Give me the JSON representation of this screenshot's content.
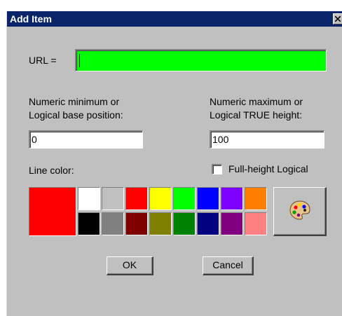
{
  "window": {
    "title": "Add Item",
    "close_icon": "close-icon"
  },
  "url": {
    "label": "URL =",
    "value": ""
  },
  "minimum": {
    "label_line1": "Numeric minimum or",
    "label_line2": "Logical base position:",
    "value": "0"
  },
  "maximum": {
    "label_line1": "Numeric maximum or",
    "label_line2": "Logical TRUE height:",
    "value": "100"
  },
  "line_color": {
    "label": "Line color:",
    "selected": "#ff0000"
  },
  "full_height": {
    "label": "Full-height Logical",
    "checked": false
  },
  "swatches_top": [
    "#ffffff",
    "#c0c0c0",
    "#ff0000",
    "#ffff00",
    "#00ff00",
    "#0000ff",
    "#8000ff",
    "#ff8000"
  ],
  "swatches_bottom": [
    "#000000",
    "#808080",
    "#800000",
    "#808000",
    "#008000",
    "#000080",
    "#800080",
    "#ff8080"
  ],
  "palette_button": {
    "icon": "palette-icon"
  },
  "buttons": {
    "ok": "OK",
    "cancel": "Cancel"
  },
  "colors": {
    "titlebar": "#0a246a",
    "dialog_bg": "#c0c0c0",
    "url_field": "#00ff00"
  }
}
